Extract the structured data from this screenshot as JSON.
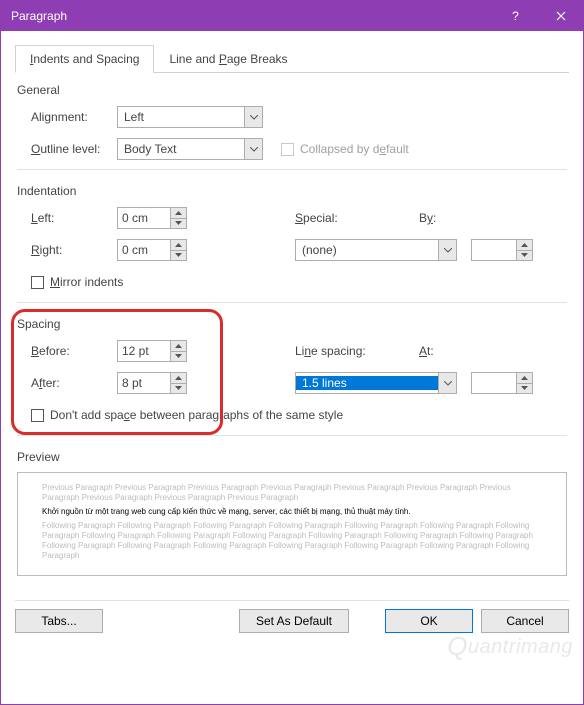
{
  "titlebar": {
    "title": "Paragraph"
  },
  "tabs": {
    "t1": "Indents and Spacing",
    "t2": "Line and Page Breaks",
    "t1_ul": "I",
    "t2_ul": "P",
    "t2_pre": "Line and ",
    "t2_post": "age Breaks"
  },
  "general": {
    "legend": "General",
    "alignment_label_pre": "Ali",
    "alignment_label_ul": "g",
    "alignment_label_post": "nment:",
    "alignment_value": "Left",
    "outline_label_ul": "O",
    "outline_label_post": "utline level:",
    "outline_value": "Body Text",
    "collapsed_label_pre": "Collapsed by d",
    "collapsed_label_ul": "e",
    "collapsed_label_post": "fault"
  },
  "indent": {
    "legend": "Indentation",
    "left_ul": "L",
    "left_post": "eft:",
    "left_val": "0 cm",
    "right_ul": "R",
    "right_post": "ight:",
    "right_val": "0 cm",
    "special_ul": "S",
    "special_post": "pecial:",
    "special_val": "(none)",
    "by_pre": "B",
    "by_ul": "y",
    "by_post": ":",
    "by_val": "",
    "mirror_ul": "M",
    "mirror_post": "irror indents"
  },
  "spacing": {
    "legend": "Spacing",
    "before_ul": "B",
    "before_post": "efore:",
    "before_val": "12 pt",
    "after_pre": "A",
    "after_ul": "f",
    "after_post": "ter:",
    "after_val": "8 pt",
    "line_pre": "Li",
    "line_ul": "n",
    "line_post": "e spacing:",
    "line_val": "1.5 lines",
    "at_ul": "A",
    "at_post": "t:",
    "at_val": "",
    "dont_pre": "Don't add spa",
    "dont_ul": "c",
    "dont_post": "e between paragraphs of the same style"
  },
  "preview": {
    "legend": "Preview",
    "prev_line": "Previous Paragraph Previous Paragraph Previous Paragraph Previous Paragraph Previous Paragraph Previous Paragraph Previous Paragraph Previous Paragraph Previous Paragraph Previous Paragraph",
    "sample": "Khởi nguồn từ một trang web cung cấp kiến thức về mạng, server, các thiết bị mạng, thủ thuật máy tính.",
    "foll_line": "Following Paragraph Following Paragraph Following Paragraph Following Paragraph Following Paragraph Following Paragraph Following Paragraph Following Paragraph Following Paragraph Following Paragraph Following Paragraph Following Paragraph Following Paragraph Following Paragraph Following Paragraph Following Paragraph Following Paragraph Following Paragraph Following Paragraph Following Paragraph"
  },
  "footer": {
    "tabs_ul": "T",
    "tabs_post": "abs...",
    "default_pre": "Set As ",
    "default_ul": "D",
    "default_post": "efault",
    "ok": "OK",
    "cancel": "Cancel"
  },
  "watermark": "uantrimang"
}
